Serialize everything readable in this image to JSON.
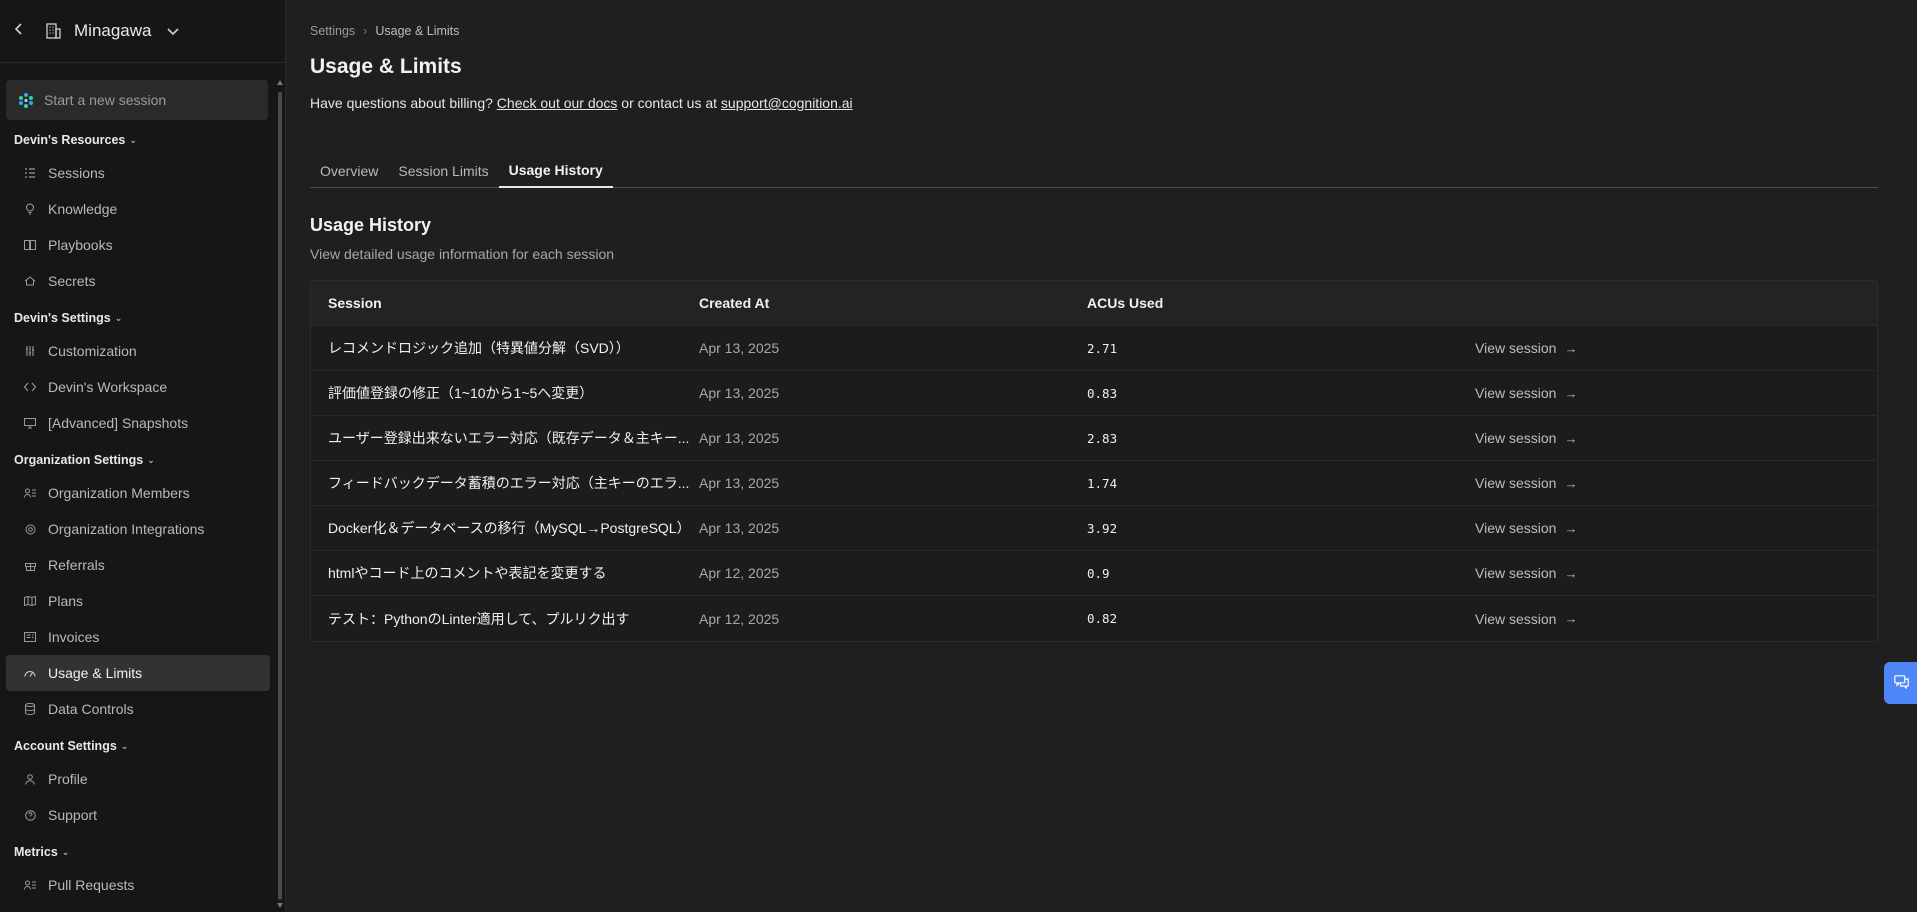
{
  "sidebar": {
    "org_name": "Minagawa",
    "new_session_placeholder": "Start a new session",
    "sections": [
      {
        "label": "Devin's Resources",
        "items": [
          {
            "label": "Sessions",
            "icon": "list-icon"
          },
          {
            "label": "Knowledge",
            "icon": "lightbulb-icon"
          },
          {
            "label": "Playbooks",
            "icon": "book-icon"
          },
          {
            "label": "Secrets",
            "icon": "vault-icon"
          }
        ]
      },
      {
        "label": "Devin's Settings",
        "items": [
          {
            "label": "Customization",
            "icon": "sliders-icon"
          },
          {
            "label": "Devin's Workspace",
            "icon": "code-icon"
          },
          {
            "label": "[Advanced] Snapshots",
            "icon": "monitor-icon"
          }
        ]
      },
      {
        "label": "Organization Settings",
        "items": [
          {
            "label": "Organization Members",
            "icon": "users-icon"
          },
          {
            "label": "Organization Integrations",
            "icon": "integrations-icon"
          },
          {
            "label": "Referrals",
            "icon": "gift-icon"
          },
          {
            "label": "Plans",
            "icon": "map-icon"
          },
          {
            "label": "Invoices",
            "icon": "receipt-icon"
          },
          {
            "label": "Usage & Limits",
            "icon": "gauge-icon",
            "active": true
          },
          {
            "label": "Data Controls",
            "icon": "database-icon"
          }
        ]
      },
      {
        "label": "Account Settings",
        "items": [
          {
            "label": "Profile",
            "icon": "user-icon"
          },
          {
            "label": "Support",
            "icon": "help-icon"
          }
        ]
      },
      {
        "label": "Metrics",
        "items": [
          {
            "label": "Pull Requests",
            "icon": "users-icon"
          }
        ]
      }
    ]
  },
  "main": {
    "breadcrumb": {
      "parent": "Settings",
      "current": "Usage & Limits"
    },
    "title": "Usage & Limits",
    "help": {
      "prefix": "Have questions about billing? ",
      "docs_link": "Check out our docs",
      "middle": " or contact us at ",
      "email_link": "support@cognition.ai"
    },
    "tabs": [
      {
        "label": "Overview"
      },
      {
        "label": "Session Limits"
      },
      {
        "label": "Usage History",
        "active": true
      }
    ],
    "section": {
      "title": "Usage History",
      "subtitle": "View detailed usage information for each session"
    },
    "table": {
      "headers": [
        "Session",
        "Created At",
        "ACUs Used",
        ""
      ],
      "view_label": "View session",
      "rows": [
        {
          "session": "レコメンドロジック追加（特異値分解（SVD））",
          "created": "Apr 13, 2025",
          "acus": "2.71"
        },
        {
          "session": "評価値登録の修正（1~10から1~5へ変更）",
          "created": "Apr 13, 2025",
          "acus": "0.83"
        },
        {
          "session": "ユーザー登録出来ないエラー対応（既存データ＆主キー...",
          "created": "Apr 13, 2025",
          "acus": "2.83"
        },
        {
          "session": "フィードバックデータ蓄積のエラー対応（主キーのエラ...",
          "created": "Apr 13, 2025",
          "acus": "1.74"
        },
        {
          "session": "Docker化＆データベースの移行（MySQL→PostgreSQL）",
          "created": "Apr 13, 2025",
          "acus": "3.92"
        },
        {
          "session": "htmlやコード上のコメントや表記を変更する",
          "created": "Apr 12, 2025",
          "acus": "0.9"
        },
        {
          "session": "テスト：PythonのLinter適用して、プルリク出す",
          "created": "Apr 12, 2025",
          "acus": "0.82"
        }
      ]
    }
  },
  "colors": {
    "background": "#1f1f1f",
    "sidebar": "#161616",
    "accent": "#4f86f7"
  }
}
